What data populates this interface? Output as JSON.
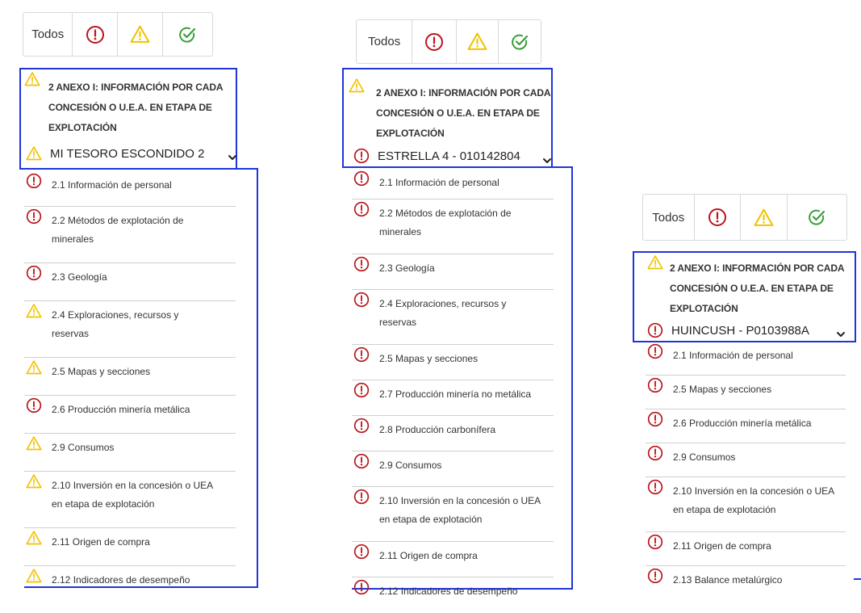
{
  "colors": {
    "error": "#b9151b",
    "warning": "#f2c200",
    "success": "#3a9e3a",
    "highlight_border": "#1f35d8",
    "divider": "#cfcfcf"
  },
  "panels": [
    {
      "filters": {
        "all_label": "Todos",
        "error_icon": "error-icon",
        "warning_icon": "warning-icon",
        "ok_icon": "check-circle-icon"
      },
      "section_title_lines": [
        "2 ANEXO I: INFORMACIÓN POR CADA",
        "CONCESIÓN O U.E.A. EN ETAPA DE",
        "EXPLOTACIÓN"
      ],
      "header_status": "warning",
      "selected": {
        "status": "warning",
        "label": "MI TESORO ESCONDIDO 2"
      },
      "items": [
        {
          "status": "error",
          "lines": [
            "2.1 Información de personal"
          ]
        },
        {
          "status": "error",
          "lines": [
            "2.2 Métodos de explotación de",
            "minerales"
          ]
        },
        {
          "status": "error",
          "lines": [
            "2.3 Geología"
          ]
        },
        {
          "status": "warning",
          "lines": [
            "2.4 Exploraciones, recursos y",
            "reservas"
          ]
        },
        {
          "status": "warning",
          "lines": [
            "2.5 Mapas y secciones"
          ]
        },
        {
          "status": "error",
          "lines": [
            "2.6 Producción minería metálica"
          ]
        },
        {
          "status": "warning",
          "lines": [
            "2.9 Consumos"
          ]
        },
        {
          "status": "warning",
          "lines": [
            "2.10 Inversión en la concesión o UEA",
            "en etapa de explotación"
          ]
        },
        {
          "status": "warning",
          "lines": [
            "2.11 Origen de compra"
          ]
        },
        {
          "status": "warning",
          "lines": [
            "2.12 Indicadores de desempeño"
          ]
        }
      ]
    },
    {
      "filters": {
        "all_label": "Todos",
        "error_icon": "error-icon",
        "warning_icon": "warning-icon",
        "ok_icon": "check-circle-icon"
      },
      "section_title_lines": [
        "2 ANEXO I: INFORMACIÓN POR CADA",
        "CONCESIÓN O U.E.A. EN ETAPA DE",
        "EXPLOTACIÓN"
      ],
      "header_status": "warning",
      "selected": {
        "status": "error",
        "label": "ESTRELLA 4 - 010142804"
      },
      "items": [
        {
          "status": "error",
          "lines": [
            "2.1 Información de personal"
          ]
        },
        {
          "status": "error",
          "lines": [
            "2.2 Métodos de explotación de",
            "minerales"
          ]
        },
        {
          "status": "error",
          "lines": [
            "2.3 Geología"
          ]
        },
        {
          "status": "error",
          "lines": [
            "2.4 Exploraciones, recursos y",
            "reservas"
          ]
        },
        {
          "status": "error",
          "lines": [
            "2.5 Mapas y secciones"
          ]
        },
        {
          "status": "error",
          "lines": [
            "2.7 Producción minería no metálica"
          ]
        },
        {
          "status": "error",
          "lines": [
            "2.8 Producción carbonífera"
          ]
        },
        {
          "status": "error",
          "lines": [
            "2.9 Consumos"
          ]
        },
        {
          "status": "error",
          "lines": [
            "2.10 Inversión en la concesión o UEA",
            "en etapa de explotación"
          ]
        },
        {
          "status": "error",
          "lines": [
            "2.11 Origen de compra"
          ]
        },
        {
          "status": "error",
          "lines": [
            "2.12 Indicadores de desempeño"
          ]
        }
      ]
    },
    {
      "filters": {
        "all_label": "Todos",
        "error_icon": "error-icon",
        "warning_icon": "warning-icon",
        "ok_icon": "check-circle-icon"
      },
      "section_title_lines": [
        "2 ANEXO I: INFORMACIÓN POR CADA",
        "CONCESIÓN O U.E.A. EN ETAPA DE",
        "EXPLOTACIÓN"
      ],
      "header_status": "warning",
      "selected": {
        "status": "error",
        "label": "HUINCUSH - P0103988A"
      },
      "items": [
        {
          "status": "error",
          "lines": [
            "2.1 Información de personal"
          ]
        },
        {
          "status": "error",
          "lines": [
            "2.5 Mapas y secciones"
          ]
        },
        {
          "status": "error",
          "lines": [
            "2.6 Producción minería metálica"
          ]
        },
        {
          "status": "error",
          "lines": [
            "2.9 Consumos"
          ]
        },
        {
          "status": "error",
          "lines": [
            "2.10 Inversión en la concesión o UEA",
            "en etapa de explotación"
          ]
        },
        {
          "status": "error",
          "lines": [
            "2.11 Origen de compra"
          ]
        },
        {
          "status": "error",
          "lines": [
            "2.13 Balance metalúrgico"
          ]
        }
      ]
    }
  ]
}
